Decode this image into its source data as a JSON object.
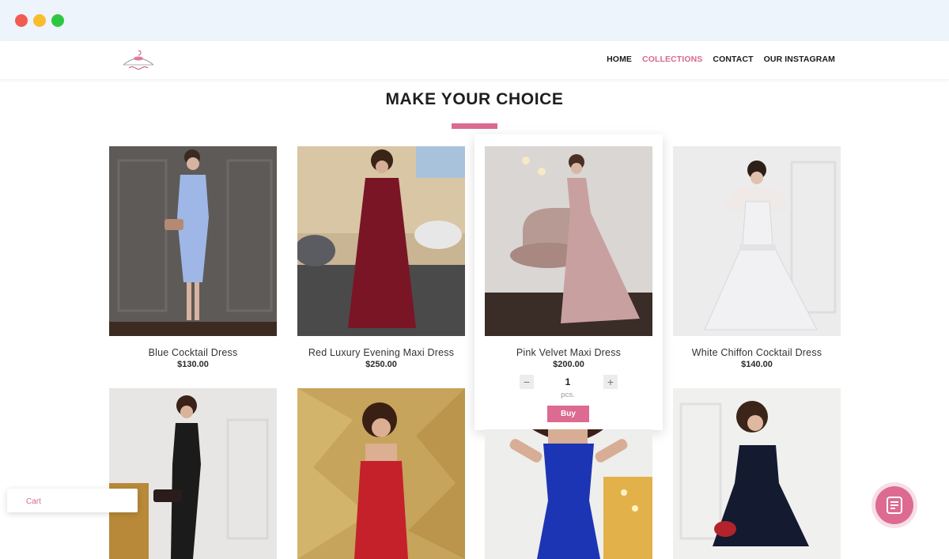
{
  "nav": {
    "items": [
      {
        "label": "HOME",
        "active": false
      },
      {
        "label": "COLLECTIONS",
        "active": true
      },
      {
        "label": "CONTACT",
        "active": false
      },
      {
        "label": "OUR INSTAGRAM",
        "active": false
      }
    ]
  },
  "section": {
    "heading": "MAKE YOUR CHOICE"
  },
  "products": [
    {
      "name": "Blue Cocktail Dress",
      "price": "$130.00",
      "dress_color": "#9fb7e6"
    },
    {
      "name": "Red Luxury Evening Maxi Dress",
      "price": "$250.00",
      "dress_color": "#7a1526"
    },
    {
      "name": "Pink Velvet Maxi Dress",
      "price": "$200.00",
      "dress_color": "#c9a0a0"
    },
    {
      "name": "White Chiffon Cocktail Dress",
      "price": "$140.00",
      "dress_color": "#f1f1f3"
    },
    {
      "dress_color": "#1b1b1b"
    },
    {
      "dress_color": "#c4212b"
    },
    {
      "dress_color": "#1c35b5"
    },
    {
      "dress_color": "#141a30"
    }
  ],
  "hovered_product": {
    "quantity": "1",
    "unit": "pcs.",
    "decrement_icon": "minus-icon",
    "increment_icon": "plus-icon",
    "buy_label": "Buy"
  },
  "cart": {
    "label": "Cart"
  },
  "chat_button": {
    "icon": "chat-document-icon"
  },
  "colors": {
    "accent": "#dc6a91",
    "text": "#1e1e1e"
  }
}
